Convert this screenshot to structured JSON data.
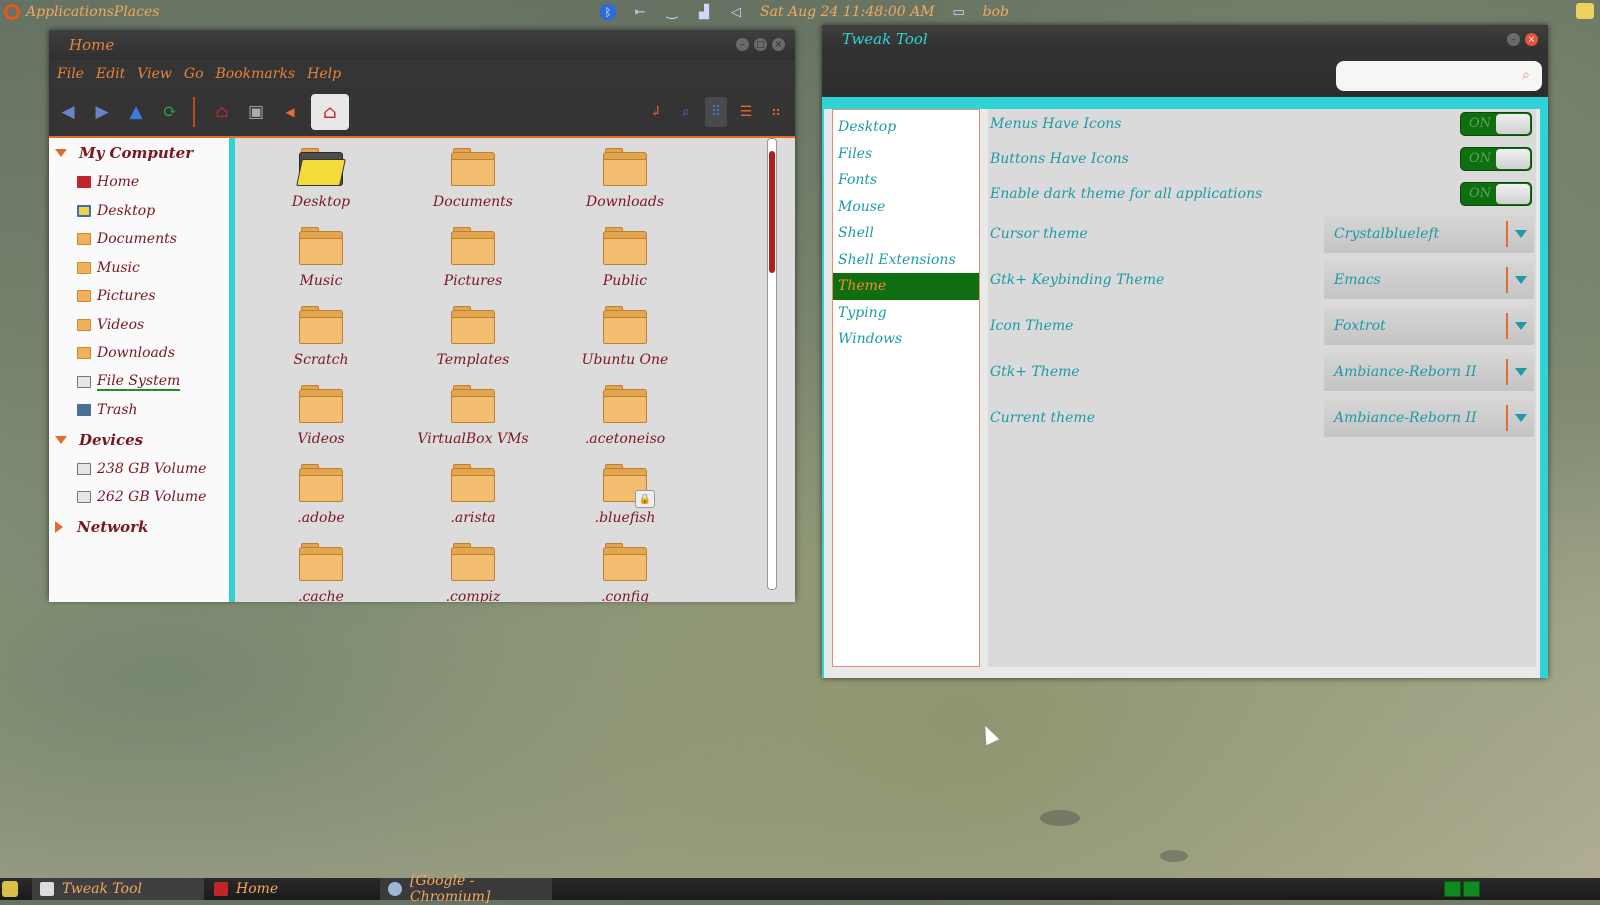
{
  "top_panel": {
    "menu_label": "ApplicationsPlaces",
    "clock": "Sat Aug 24  11:48:00 AM",
    "user": "bob",
    "icons": [
      "bluetooth-icon",
      "back-arrow-icon",
      "network-icon",
      "signal-icon",
      "volume-icon",
      "user-icon"
    ]
  },
  "file_manager": {
    "title": "Home",
    "menu": [
      "File",
      "Edit",
      "View",
      "Go",
      "Bookmarks",
      "Help"
    ],
    "sidebar": {
      "sections": [
        {
          "title": "My Computer",
          "items": [
            "Home",
            "Desktop",
            "Documents",
            "Music",
            "Pictures",
            "Videos",
            "Downloads",
            "File System",
            "Trash"
          ]
        },
        {
          "title": "Devices",
          "items": [
            "238 GB Volume",
            "262 GB Volume"
          ]
        },
        {
          "title": "Network",
          "items": []
        }
      ]
    },
    "files": [
      "Desktop",
      "Documents",
      "Downloads",
      "Music",
      "Pictures",
      "Public",
      "Scratch",
      "Templates",
      "Ubuntu One",
      "Videos",
      "VirtualBox VMs",
      ".acetoneiso",
      ".adobe",
      ".arista",
      ".bluefish",
      ".cache",
      ".compiz",
      ".config"
    ]
  },
  "tweak_tool": {
    "title": "Tweak Tool",
    "search_placeholder": "",
    "categories": [
      "Desktop",
      "Files",
      "Fonts",
      "Mouse",
      "Shell",
      "Shell Extensions",
      "Theme",
      "Typing",
      "Windows"
    ],
    "selected_category": "Theme",
    "toggles": [
      {
        "label": "Menus Have Icons",
        "state": "ON"
      },
      {
        "label": "Buttons Have Icons",
        "state": "ON"
      },
      {
        "label": "Enable dark theme for all applications",
        "state": "ON"
      }
    ],
    "combos": [
      {
        "label": "Cursor theme",
        "value": "Crystalblueleft"
      },
      {
        "label": "Gtk+ Keybinding Theme",
        "value": "Emacs"
      },
      {
        "label": "Icon Theme",
        "value": "Foxtrot"
      },
      {
        "label": "Gtk+ Theme",
        "value": "Ambiance-Reborn II"
      },
      {
        "label": "Current theme",
        "value": "Ambiance-Reborn II"
      }
    ]
  },
  "bottom_panel": {
    "tasks": [
      "Tweak Tool",
      "Home",
      "[Google - Chromium]"
    ]
  },
  "colors": {
    "accent_orange": "#e7833a",
    "accent_cyan": "#2fd3d6",
    "text_maroon": "#7a1620",
    "selected_green": "#0f6e0f"
  }
}
